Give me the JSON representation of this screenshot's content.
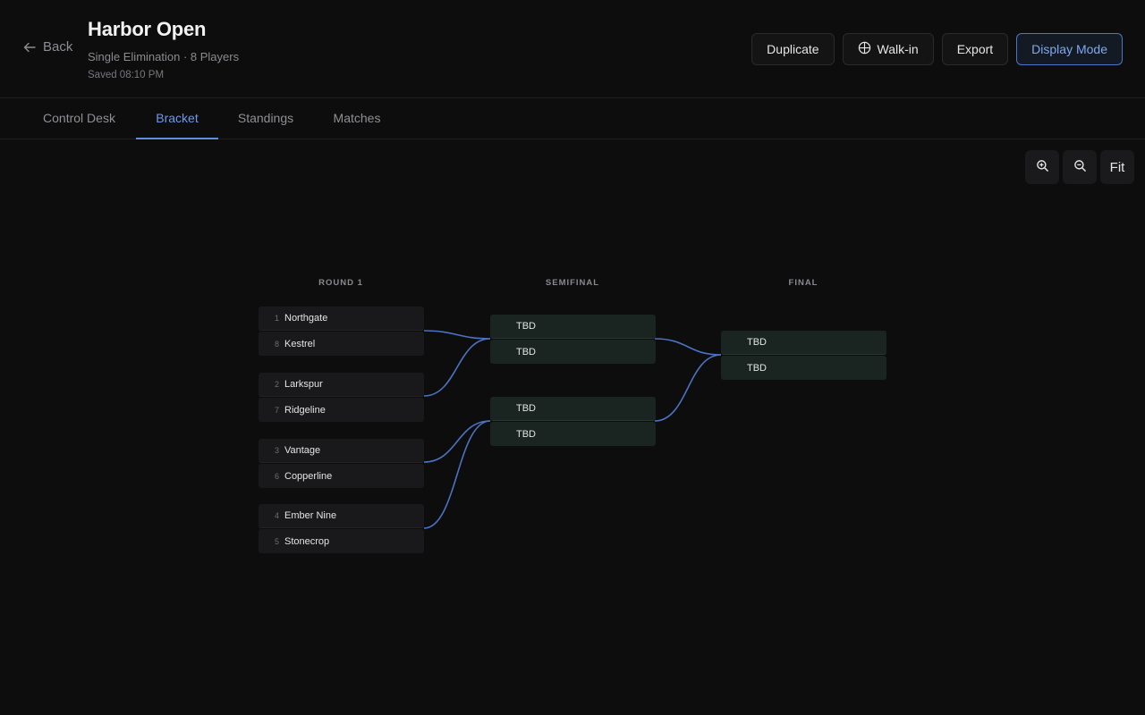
{
  "header": {
    "back_label": "Back",
    "title": "Harbor Open",
    "subtitle": "Single Elimination · 8 Players",
    "saved": "Saved 08:10 PM"
  },
  "actions": {
    "duplicate": "Duplicate",
    "walkin": "Walk-in",
    "export": "Export",
    "display_mode": "Display Mode"
  },
  "tabs": [
    {
      "label": "Control Desk",
      "active": false
    },
    {
      "label": "Bracket",
      "active": true
    },
    {
      "label": "Standings",
      "active": false
    },
    {
      "label": "Matches",
      "active": false
    }
  ],
  "zoom": {
    "zoom_in_icon": "zoom-in-icon",
    "zoom_out_icon": "zoom-out-icon",
    "fit_label": "Fit"
  },
  "bracket": {
    "rounds": [
      "ROUND 1",
      "SEMIFINAL",
      "FINAL"
    ],
    "round1": [
      {
        "top": {
          "seed": "1",
          "name": "Northgate"
        },
        "bottom": {
          "seed": "8",
          "name": "Kestrel"
        }
      },
      {
        "top": {
          "seed": "2",
          "name": "Larkspur"
        },
        "bottom": {
          "seed": "7",
          "name": "Ridgeline"
        }
      },
      {
        "top": {
          "seed": "3",
          "name": "Vantage"
        },
        "bottom": {
          "seed": "6",
          "name": "Copperline"
        }
      },
      {
        "top": {
          "seed": "4",
          "name": "Ember Nine"
        },
        "bottom": {
          "seed": "5",
          "name": "Stonecrop"
        }
      }
    ],
    "semifinal": [
      {
        "top": "TBD",
        "bottom": "TBD"
      },
      {
        "top": "TBD",
        "bottom": "TBD"
      }
    ],
    "final": [
      {
        "top": "TBD",
        "bottom": "TBD"
      }
    ]
  },
  "colors": {
    "accent": "#5f8ee0",
    "connector": "#4c72c2",
    "background": "#0d0d0e",
    "pending_match": "#1a2420"
  }
}
